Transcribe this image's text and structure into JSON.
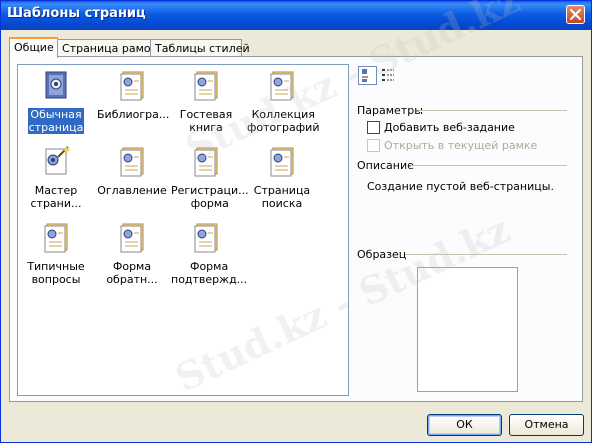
{
  "window": {
    "title": "Шаблоны страниц"
  },
  "tabs": [
    {
      "label": "Общие",
      "active": true
    },
    {
      "label": "Страница рамок",
      "active": false
    },
    {
      "label": "Таблицы стилей",
      "active": false
    }
  ],
  "templates": [
    {
      "label": "Обычная страница",
      "line1": "Обычная",
      "line2": "страница",
      "icon": "blank-page-icon",
      "selected": true
    },
    {
      "label": "Библиогра...",
      "line1": "Библиогра...",
      "line2": "",
      "icon": "page-icon"
    },
    {
      "label": "Гостевая книга",
      "line1": "Гостевая",
      "line2": "книга",
      "icon": "page-icon"
    },
    {
      "label": "Коллекция фотографий",
      "line1": "Коллекция",
      "line2": "фотографий",
      "icon": "page-icon"
    },
    {
      "label": "Мастер страни...",
      "line1": "Мастер",
      "line2": "страни...",
      "icon": "wizard-icon"
    },
    {
      "label": "Оглавление",
      "line1": "Оглавление",
      "line2": "",
      "icon": "page-icon"
    },
    {
      "label": "Регистраци... форма",
      "line1": "Регистраци...",
      "line2": "форма",
      "icon": "page-icon"
    },
    {
      "label": "Страница поиска",
      "line1": "Страница",
      "line2": "поиска",
      "icon": "page-icon"
    },
    {
      "label": "Типичные вопросы",
      "line1": "Типичные",
      "line2": "вопросы",
      "icon": "page-icon"
    },
    {
      "label": "Форма обратн...",
      "line1": "Форма",
      "line2": "обратн...",
      "icon": "page-icon"
    },
    {
      "label": "Форма подтвержд...",
      "line1": "Форма",
      "line2": "подтвержд...",
      "icon": "page-icon"
    }
  ],
  "options": {
    "heading": "Параметры",
    "add_task": {
      "label": "Добавить веб-задание",
      "checked": false,
      "enabled": true
    },
    "open_frame": {
      "label": "Открыть в текущей рамке",
      "checked": false,
      "enabled": false
    }
  },
  "description": {
    "heading": "Описание",
    "text": "Создание пустой веб-страницы."
  },
  "preview": {
    "heading": "Образец"
  },
  "buttons": {
    "ok": "ОК",
    "cancel": "Отмена"
  },
  "watermark": "Stud.kz - Stud.kz",
  "colors": {
    "title_bar": "#0b5ce3",
    "selection": "#316ac5",
    "tab_highlight": "#ff9a2e",
    "dialog_bg": "#ece9d8"
  }
}
